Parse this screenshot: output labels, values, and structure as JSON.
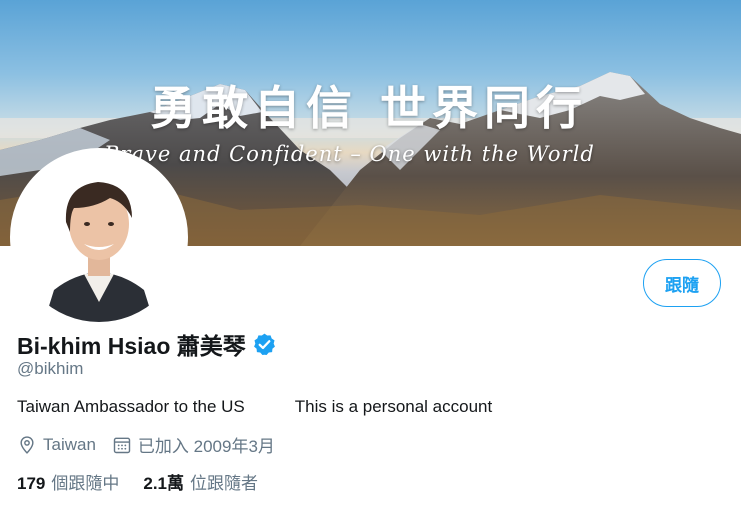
{
  "profile": {
    "banner": {
      "title": "勇敢自信 世界同行",
      "subtitle": "Brave and Confident – One with the World"
    },
    "display_name": "Bi-khim Hsiao 蕭美琴",
    "handle": "@bikhim",
    "verified": true,
    "bio_part1": "Taiwan Ambassador to the US",
    "bio_part2": "This is a personal account",
    "location": "Taiwan",
    "joined": "已加入 2009年3月",
    "follow_label": "跟隨",
    "following_count": "179",
    "following_label": "個跟隨中",
    "followers_count": "2.1萬",
    "followers_label": "位跟隨者"
  },
  "icons": {
    "verified": "verified-badge-icon",
    "location": "location-pin-icon",
    "calendar": "calendar-icon"
  },
  "colors": {
    "accent": "#1da1f2",
    "text_primary": "#14171a",
    "text_secondary": "#657786"
  }
}
